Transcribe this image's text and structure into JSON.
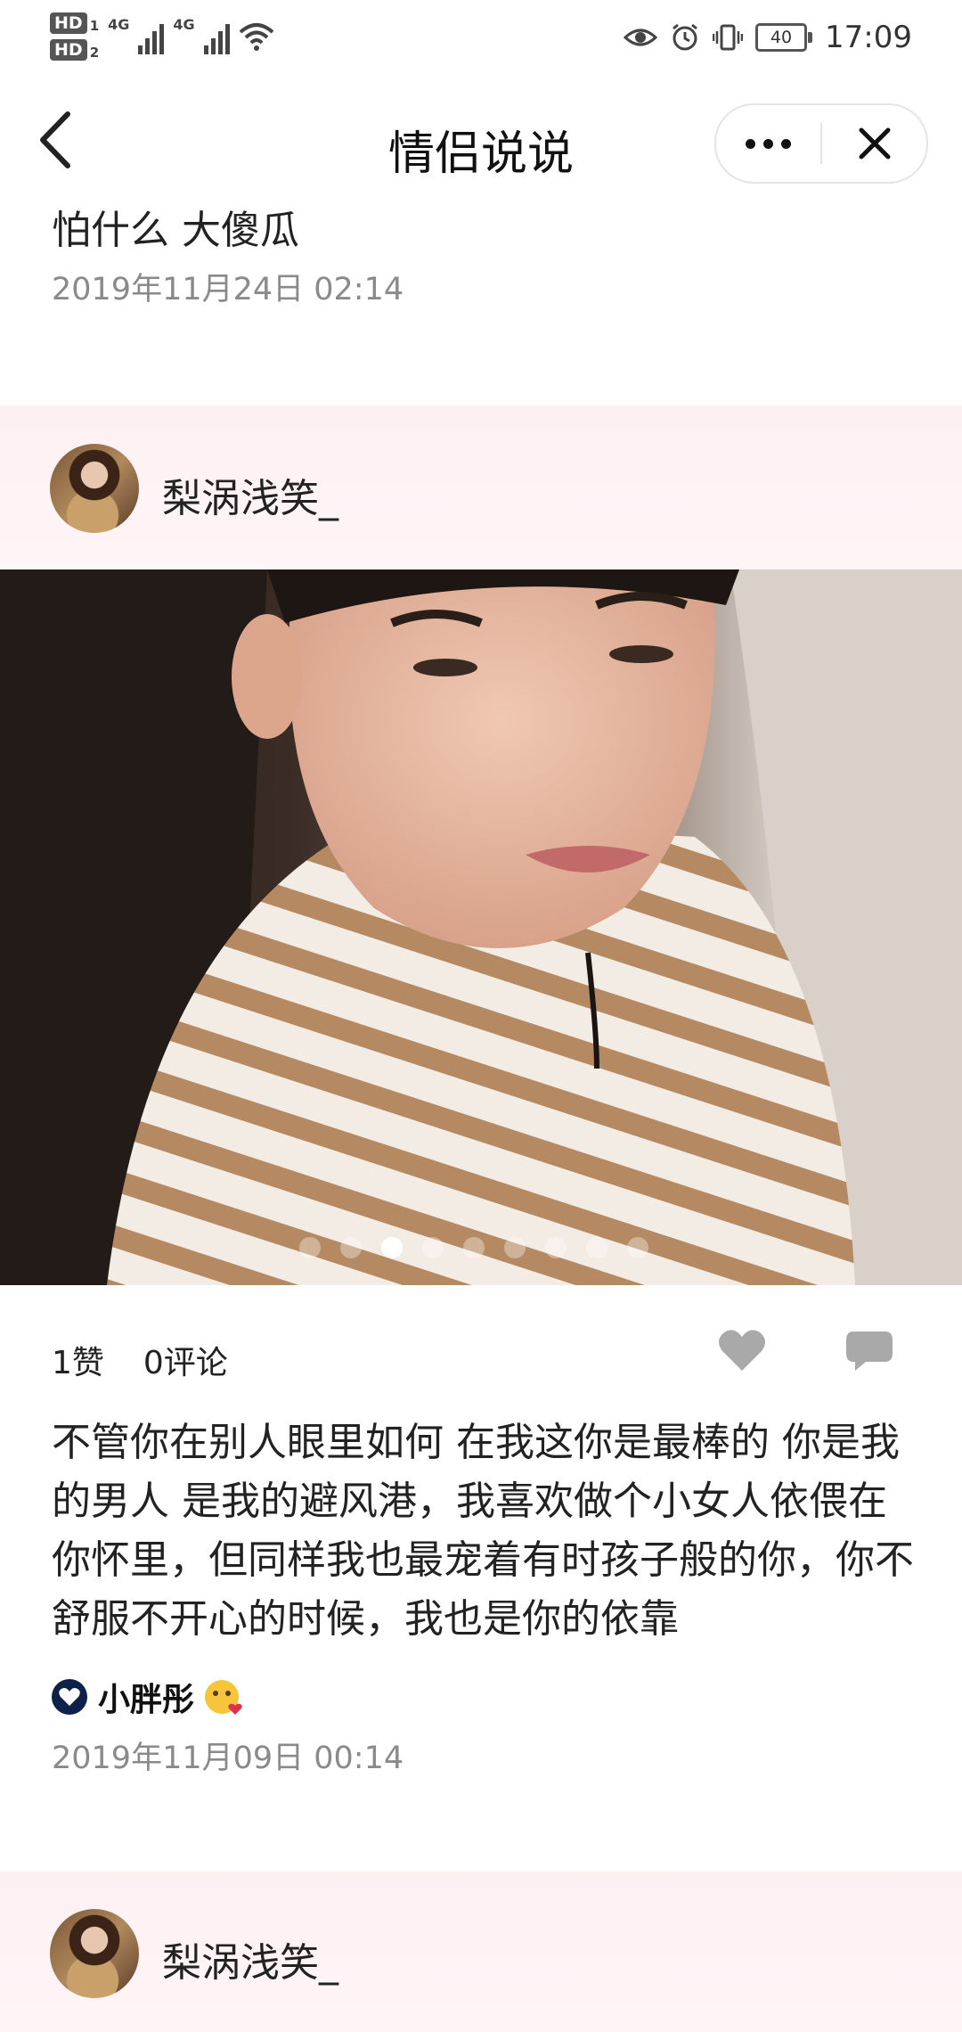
{
  "status_bar": {
    "hd1": "HD",
    "hd1_sub": "1",
    "hd2": "HD",
    "hd2_sub": "2",
    "net1": "4G",
    "net2": "4G",
    "battery": "40",
    "time": "17:09"
  },
  "header": {
    "title": "情侣说说",
    "back_icon": "chevron-left-icon",
    "more_icon": "more-dots-icon",
    "close_icon": "close-icon"
  },
  "previous_post": {
    "text": "怕什么 大傻瓜",
    "date": "2019年11月24日 02:14"
  },
  "post": {
    "user": "梨涡浅笑_",
    "photo_count": 9,
    "active_photo": 3,
    "likes": "1赞",
    "comments": "0评论",
    "body": "不管你在别人眼里如何 在我这你是最棒的 你是我的男人 是我的避风港，我喜欢做个小女人依偎在你怀里，但同样我也最宠着有时孩子般的你，你不舒服不开心的时候，我也是你的依靠",
    "tag_name": "小胖彤",
    "date": "2019年11月09日 00:14",
    "colors": {
      "tag_badge": "#0d2149",
      "icon_gray": "#a9a9a9",
      "band_pink": "#fdf0f3"
    }
  },
  "next_post": {
    "user": "梨涡浅笑_"
  }
}
